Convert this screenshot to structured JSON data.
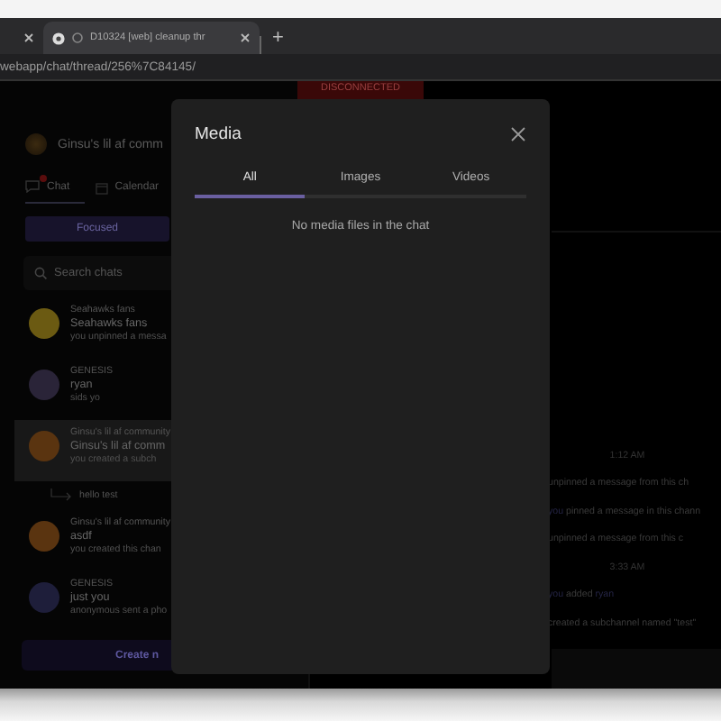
{
  "browser": {
    "tabs": [
      {
        "selected": false
      },
      {
        "title": "D10324 [web] cleanup thr",
        "selected": true
      }
    ],
    "address": "webapp/chat/thread/256%7C84145/",
    "new_tab": "+"
  },
  "banner": "DISCONNECTED",
  "sidebar": {
    "group_name": "Ginsu's lil af comm",
    "nav_tabs": [
      {
        "label": "Chat",
        "selected": true,
        "badge": true
      },
      {
        "label": "Calendar",
        "selected": false,
        "badge": false
      }
    ],
    "focus_button": "Focused",
    "search": {
      "placeholder": "Search chats"
    },
    "chats": [
      {
        "kind": "chat",
        "group": "Seahawks fans",
        "name": "Seahawks fans",
        "preview": "you unpinned a messa",
        "color": "#6b5a12",
        "selected": false
      },
      {
        "kind": "chat",
        "group": "GENESIS",
        "name": "ryan",
        "preview": "sids yo",
        "color": "#2a2438",
        "selected": false
      },
      {
        "kind": "chat",
        "group": "Ginsu's lil af community",
        "name": "Ginsu's lil af comm",
        "preview": "you created a subch",
        "color": "#5a3410",
        "selected": true
      },
      {
        "kind": "subchannel",
        "name": "hello test",
        "selected": false
      },
      {
        "kind": "chat",
        "group": "Ginsu's lil af community",
        "name": "asdf",
        "preview": "you created this chan",
        "color": "#5a3410",
        "selected": false
      },
      {
        "kind": "chat",
        "group": "GENESIS",
        "name": "just you",
        "preview": "anonymous sent a pho",
        "color": "#1e1e3a",
        "selected": false
      }
    ],
    "create_button": "Create n"
  },
  "chat_log": [
    {
      "kind": "time",
      "text": "1:12 AM"
    },
    {
      "kind": "event",
      "text": "unpinned a message from this ch"
    },
    {
      "kind": "event",
      "actor": "you",
      "text": "pinned a message in this chann"
    },
    {
      "kind": "event",
      "text": "unpinned a message from this c"
    },
    {
      "kind": "time",
      "text": "3:33 AM"
    },
    {
      "kind": "event",
      "actor": "you",
      "text": "added",
      "target": "ryan"
    },
    {
      "kind": "event",
      "text": "created a subchannel named \"test\""
    }
  ],
  "modal": {
    "title": "Media",
    "tabs": [
      {
        "label": "All",
        "selected": true
      },
      {
        "label": "Images",
        "selected": false
      },
      {
        "label": "Videos",
        "selected": false
      }
    ],
    "empty_text": "No media files in the chat"
  }
}
